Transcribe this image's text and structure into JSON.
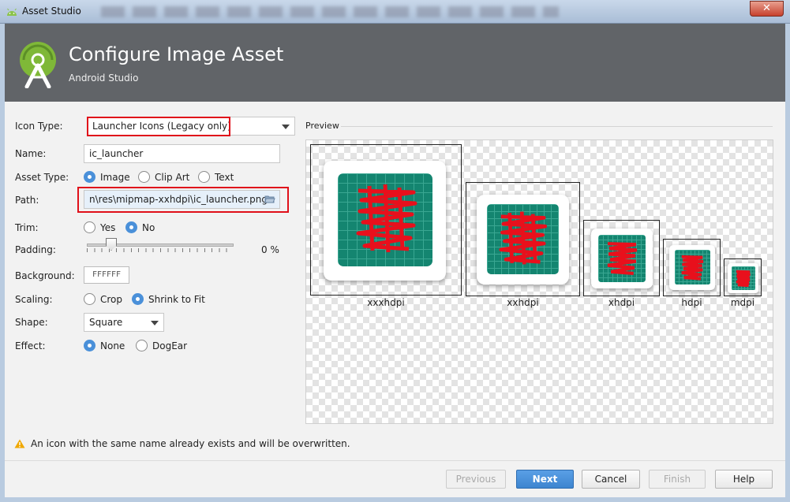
{
  "window": {
    "title": "Asset Studio",
    "close_glyph": "✕"
  },
  "header": {
    "title": "Configure Image Asset",
    "subtitle": "Android Studio",
    "logo_icon": "android-studio-logo"
  },
  "form": {
    "icon_type": {
      "label": "Icon Type:",
      "value": "Launcher Icons (Legacy only)"
    },
    "name": {
      "label": "Name:",
      "value": "ic_launcher"
    },
    "asset_type": {
      "label": "Asset Type:",
      "options": [
        "Image",
        "Clip Art",
        "Text"
      ],
      "selected": "Image"
    },
    "path": {
      "label": "Path:",
      "value": "n\\res\\mipmap-xxhdpi\\ic_launcher.png"
    },
    "trim": {
      "label": "Trim:",
      "options": [
        "Yes",
        "No"
      ],
      "selected": "No"
    },
    "padding": {
      "label": "Padding:",
      "value": "0 %",
      "fraction": 0.14
    },
    "background": {
      "label": "Background:",
      "value": "FFFFFF"
    },
    "scaling": {
      "label": "Scaling:",
      "options": [
        "Crop",
        "Shrink to Fit"
      ],
      "selected": "Shrink to Fit"
    },
    "shape": {
      "label": "Shape:",
      "value": "Square"
    },
    "effect": {
      "label": "Effect:",
      "options": [
        "None",
        "DogEar"
      ],
      "selected": "None"
    }
  },
  "preview": {
    "label": "Preview",
    "densities": [
      "xxxhdpi",
      "xxhdpi",
      "xhdpi",
      "hdpi",
      "mdpi"
    ]
  },
  "warning": {
    "text": "An icon with the same name already exists and will be overwritten.",
    "icon": "warning-icon"
  },
  "buttons": {
    "previous": "Previous",
    "next": "Next",
    "cancel": "Cancel",
    "finish": "Finish",
    "help": "Help"
  },
  "colors": {
    "accent": "#4a90d9",
    "highlight": "#e0101a",
    "icon_green": "#148570",
    "header_bg": "#616468"
  }
}
